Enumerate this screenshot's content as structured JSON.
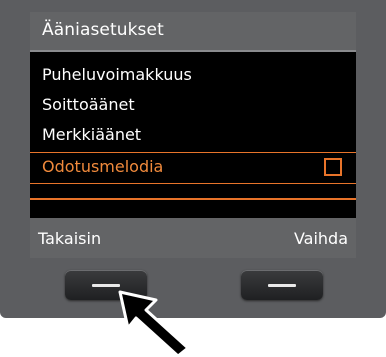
{
  "screen": {
    "title": "Ääniasetukset",
    "menu_items": [
      {
        "label": "Puheluvoimakkuus",
        "selected": false
      },
      {
        "label": "Soittoäänet",
        "selected": false
      },
      {
        "label": "Merkkiäänet",
        "selected": false
      },
      {
        "label": "Odotusmelodia",
        "selected": true,
        "checked": false
      }
    ]
  },
  "softkeys": {
    "left_label": "Takaisin",
    "right_label": "Vaihda"
  },
  "colors": {
    "accent": "#e8742a",
    "screen_background": "#000000",
    "bar_background": "#636466",
    "bezel": "#5c5d60"
  },
  "icons": {
    "pointer": "arrow-pointer-icon",
    "checkbox": "checkbox-icon"
  }
}
